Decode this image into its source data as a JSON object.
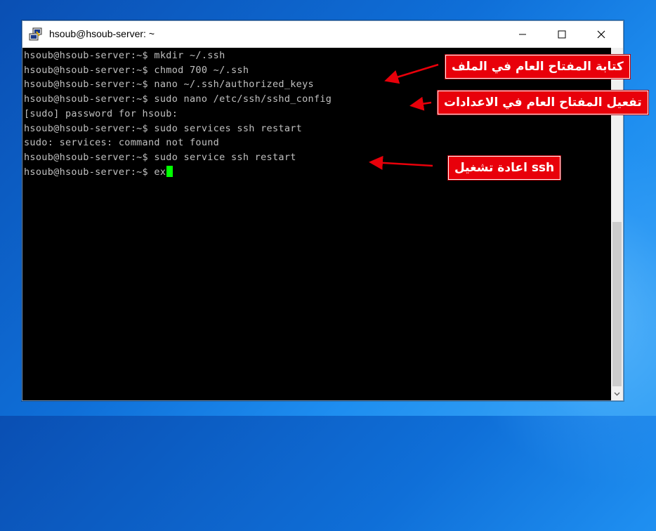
{
  "window": {
    "title": "hsoub@hsoub-server: ~"
  },
  "terminal": {
    "lines": [
      "hsoub@hsoub-server:~$ mkdir ~/.ssh",
      "hsoub@hsoub-server:~$ chmod 700 ~/.ssh",
      "hsoub@hsoub-server:~$ nano ~/.ssh/authorized_keys",
      "hsoub@hsoub-server:~$ sudo nano /etc/ssh/sshd_config",
      "[sudo] password for hsoub:",
      "hsoub@hsoub-server:~$ sudo services ssh restart",
      "sudo: services: command not found",
      "hsoub@hsoub-server:~$ sudo service ssh restart",
      "hsoub@hsoub-server:~$ ex"
    ]
  },
  "annotations": {
    "write_key": "كتابة المفتاح العام في الملف",
    "enable_key": "تفعيل المفتاح العام في الاعدادات",
    "restart_ssh": "ssh اعادة تشغيل"
  },
  "colors": {
    "terminal_bg": "#000000",
    "terminal_text": "#c0c0c0",
    "cursor": "#00ff00",
    "annotation_bg": "#e8000a"
  },
  "icons": {
    "app": "putty-icon",
    "minimize": "minimize-icon",
    "maximize": "maximize-icon",
    "close": "close-icon",
    "scroll_down": "chevron-down-icon"
  }
}
